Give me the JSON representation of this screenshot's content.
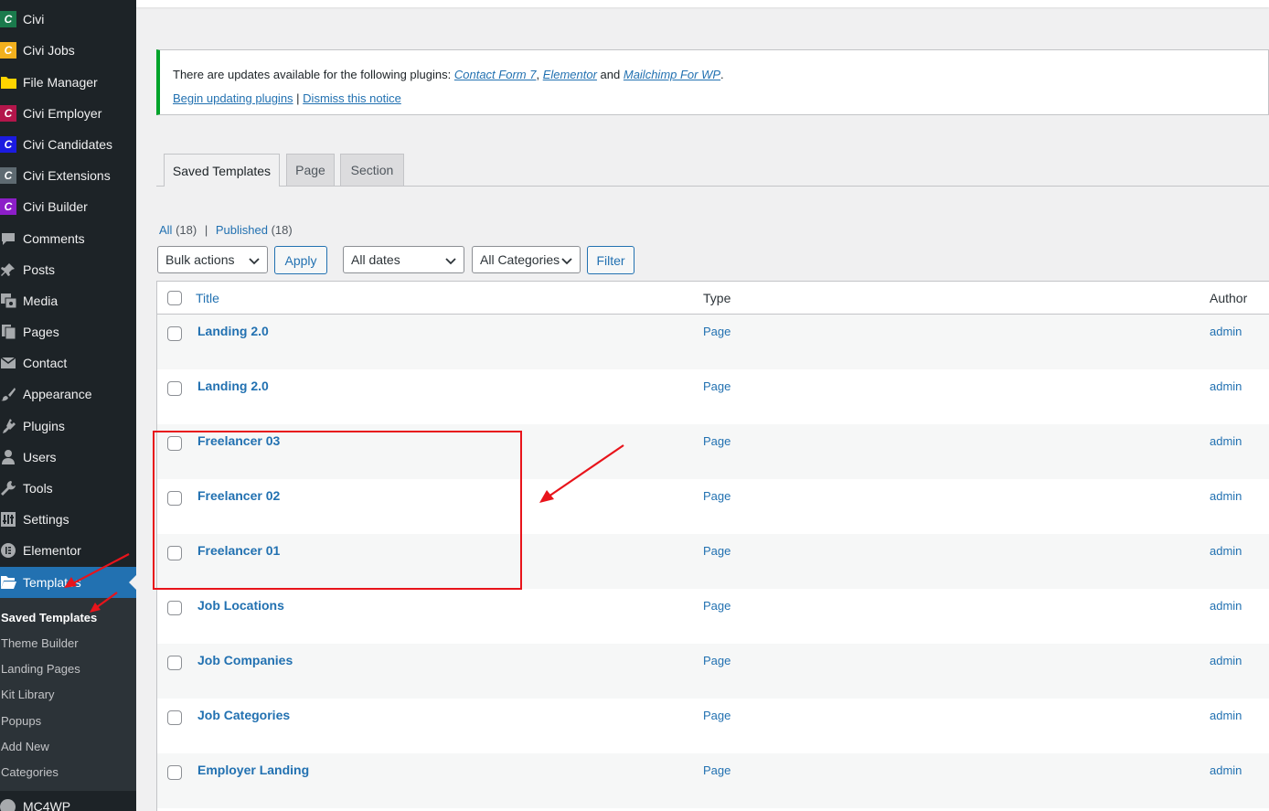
{
  "sidebar": {
    "items": [
      {
        "label": "Civi",
        "icon": "civi-logo-icon",
        "color": "#1a7a4c"
      },
      {
        "label": "Civi Jobs",
        "icon": "civi-logo-icon",
        "color": "#f2b01e"
      },
      {
        "label": "File Manager",
        "icon": "folder-icon",
        "color": "#ffd400"
      },
      {
        "label": "Civi Employer",
        "icon": "civi-logo-icon",
        "color": "#b3164b"
      },
      {
        "label": "Civi Candidates",
        "icon": "civi-logo-icon",
        "color": "#1b1be0"
      },
      {
        "label": "Civi Extensions",
        "icon": "civi-logo-icon",
        "color": "#5e6a71"
      },
      {
        "label": "Civi Builder",
        "icon": "civi-logo-icon",
        "color": "#8c1ec8"
      },
      {
        "label": "Comments",
        "icon": "comment-icon"
      },
      {
        "label": "Posts",
        "icon": "pushpin-icon"
      },
      {
        "label": "Media",
        "icon": "media-icon"
      },
      {
        "label": "Pages",
        "icon": "pages-icon"
      },
      {
        "label": "Contact",
        "icon": "envelope-icon"
      },
      {
        "label": "Appearance",
        "icon": "paintbrush-icon"
      },
      {
        "label": "Plugins",
        "icon": "plugin-icon"
      },
      {
        "label": "Users",
        "icon": "user-icon"
      },
      {
        "label": "Tools",
        "icon": "wrench-icon"
      },
      {
        "label": "Settings",
        "icon": "settings-icon"
      },
      {
        "label": "Elementor",
        "icon": "elementor-icon"
      },
      {
        "label": "Templates",
        "icon": "folder-open-icon",
        "current": true
      }
    ],
    "submenu": [
      {
        "label": "Saved Templates",
        "current": true
      },
      {
        "label": "Theme Builder"
      },
      {
        "label": "Landing Pages"
      },
      {
        "label": "Kit Library"
      },
      {
        "label": "Popups"
      },
      {
        "label": "Add New"
      },
      {
        "label": "Categories"
      }
    ],
    "mc4wp_label": "MC4WP"
  },
  "notice": {
    "text_before": "There are updates available for the following plugins: ",
    "plugins": [
      "Contact Form 7",
      "Elementor",
      "Mailchimp For WP"
    ],
    "sep1": ", ",
    "sep2": " and ",
    "end": ".",
    "update_link": "Begin updating plugins",
    "divider": " | ",
    "dismiss_link": "Dismiss this notice",
    "accent": "#00a32a"
  },
  "tabs": [
    {
      "label": "Saved Templates",
      "active": true
    },
    {
      "label": "Page"
    },
    {
      "label": "Section"
    }
  ],
  "views": {
    "all_label": "All",
    "all_count": "(18)",
    "sep": "|",
    "published_label": "Published",
    "published_count": "(18)"
  },
  "controls": {
    "bulk_actions": "Bulk actions",
    "apply": "Apply",
    "dates": "All dates",
    "categories": "All Categories",
    "filter": "Filter"
  },
  "table": {
    "headers": {
      "title": "Title",
      "type": "Type",
      "author": "Author"
    },
    "rows": [
      {
        "title": "Landing 2.0",
        "type": "Page",
        "author": "admin"
      },
      {
        "title": "Landing 2.0",
        "type": "Page",
        "author": "admin"
      },
      {
        "title": "Freelancer 03",
        "type": "Page",
        "author": "admin"
      },
      {
        "title": "Freelancer 02",
        "type": "Page",
        "author": "admin"
      },
      {
        "title": "Freelancer 01",
        "type": "Page",
        "author": "admin"
      },
      {
        "title": "Job Locations",
        "type": "Page",
        "author": "admin"
      },
      {
        "title": "Job Companies",
        "type": "Page",
        "author": "admin"
      },
      {
        "title": "Job Categories",
        "type": "Page",
        "author": "admin"
      },
      {
        "title": "Employer Landing",
        "type": "Page",
        "author": "admin"
      }
    ]
  },
  "annotation_color": "#e8141b"
}
